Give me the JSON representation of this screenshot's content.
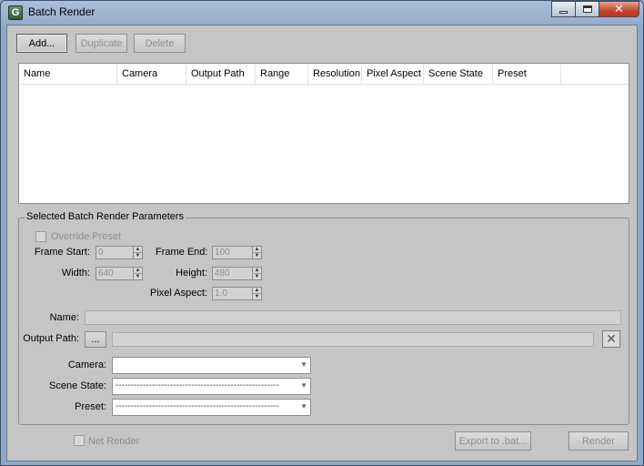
{
  "window": {
    "title": "Batch Render",
    "app_icon": "3ds-max-logo-icon",
    "app_icon_glyph": "G"
  },
  "caption": {
    "minimize": "minimize-icon",
    "maximize": "maximize-icon",
    "close_glyph": "✕"
  },
  "toolbar": {
    "add_label": "Add...",
    "duplicate_label": "Duplicate",
    "delete_label": "Delete"
  },
  "table": {
    "columns": [
      "Name",
      "Camera",
      "Output Path",
      "Range",
      "Resolution",
      "Pixel Aspect",
      "Scene State",
      "Preset"
    ],
    "rows": []
  },
  "params": {
    "group_title": "Selected Batch Render Parameters",
    "override_preset_label": "Override Preset",
    "frame_start_label": "Frame Start:",
    "frame_start_value": "0",
    "frame_end_label": "Frame End:",
    "frame_end_value": "100",
    "width_label": "Width:",
    "width_value": "640",
    "height_label": "Height:",
    "height_value": "480",
    "pixel_aspect_label": "Pixel Aspect:",
    "pixel_aspect_value": "1,0",
    "name_label": "Name:",
    "name_value": "",
    "output_path_label": "Output Path:",
    "browse_label": "...",
    "output_path_value": "",
    "clear_glyph": "✕",
    "camera_label": "Camera:",
    "camera_value": "",
    "scene_state_label": "Scene State:",
    "scene_state_value": "------------------------------------------------------",
    "preset_label": "Preset:",
    "preset_value": "------------------------------------------------------"
  },
  "footer": {
    "net_render_label": "Net Render",
    "export_label": "Export to .bat...",
    "render_label": "Render"
  },
  "colors": {
    "dialog_bg": "#c5c5c5",
    "disabled_text": "#8e8e8e",
    "title_bar": "#8ea9c9",
    "close_button": "#c7452b"
  }
}
